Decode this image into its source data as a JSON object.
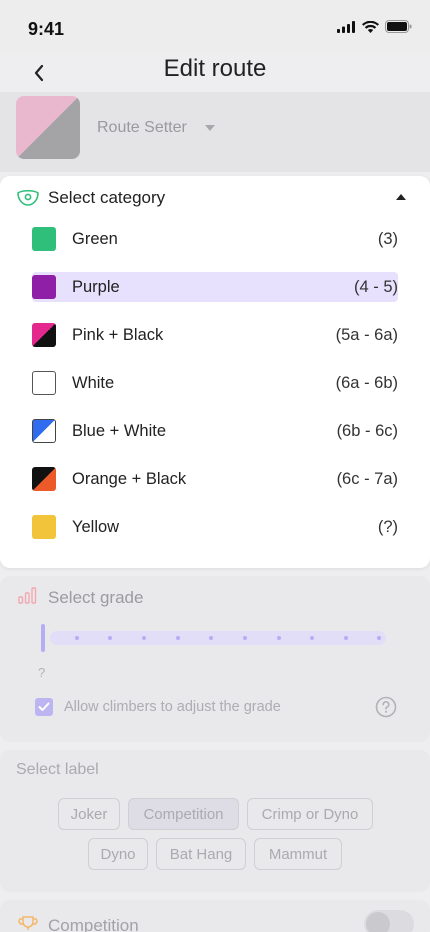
{
  "status": {
    "time": "9:41"
  },
  "nav": {
    "title": "Edit route"
  },
  "setter": {
    "placeholder": "Route Setter"
  },
  "category": {
    "header": "Select category",
    "options": [
      {
        "name": "Green",
        "grade": "(3)",
        "color": "#2fbf7b"
      },
      {
        "name": "Purple",
        "grade": "(4 - 5)",
        "color": "#8e1fa6"
      },
      {
        "name": "Pink + Black",
        "grade": "(5a - 6a)",
        "color": "#e4298e",
        "color2": "#111111"
      },
      {
        "name": "White",
        "grade": "(6a - 6b)",
        "color": "#ffffff"
      },
      {
        "name": "Blue + White",
        "grade": "(6b - 6c)",
        "color": "#2f6cf0",
        "color2": "#ffffff"
      },
      {
        "name": "Orange + Black",
        "grade": "(6c - 7a)",
        "color": "#ec5a2a",
        "color2": "#111111"
      },
      {
        "name": "Yellow",
        "grade": "(?)",
        "color": "#f2c43a"
      }
    ],
    "selected": "Purple"
  },
  "grade": {
    "title": "Select grade",
    "value": "?",
    "adjust_label": "Allow climbers to adjust the grade",
    "adjust_checked": true
  },
  "labels": {
    "title": "Select label",
    "chips": [
      "Joker",
      "Competition",
      "Crimp or Dyno",
      "Dyno",
      "Bat Hang",
      "Mammut"
    ],
    "active": "Competition"
  },
  "competition": {
    "label": "Competition",
    "enabled": false
  },
  "colors": {
    "accent": "#b6aef5",
    "selected_bg": "#e8e1fd"
  }
}
